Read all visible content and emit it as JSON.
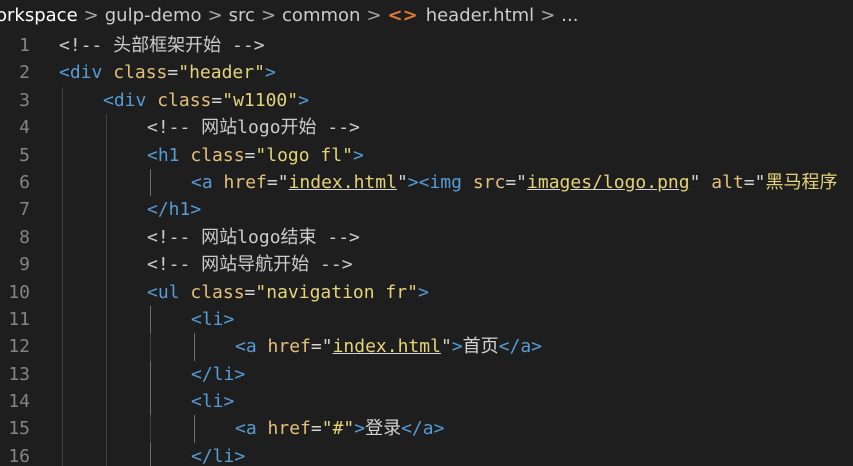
{
  "breadcrumb": [
    {
      "label": "orkspace",
      "icon": null
    },
    {
      "label": "gulp-demo",
      "icon": null
    },
    {
      "label": "src",
      "icon": null
    },
    {
      "label": "common",
      "icon": null
    },
    {
      "label": "header.html",
      "icon": "html-file-icon"
    },
    {
      "label": "...",
      "icon": null
    }
  ],
  "breadcrumb_separator": ">",
  "file_icon_glyph": "<>",
  "lines": [
    {
      "number": "1",
      "indent": 0,
      "tokens": [
        {
          "t": "comment",
          "v": "<!-- 头部框架开始 -->"
        }
      ]
    },
    {
      "number": "2",
      "indent": 0,
      "tokens": [
        {
          "t": "tag",
          "v": "<div"
        },
        {
          "t": "space",
          "v": " "
        },
        {
          "t": "attr",
          "v": "class"
        },
        {
          "t": "punc",
          "v": "="
        },
        {
          "t": "str",
          "v": "\"header\""
        },
        {
          "t": "tag",
          "v": ">"
        }
      ]
    },
    {
      "number": "3",
      "indent": 1,
      "tokens": [
        {
          "t": "tag",
          "v": "<div"
        },
        {
          "t": "space",
          "v": " "
        },
        {
          "t": "attr",
          "v": "class"
        },
        {
          "t": "punc",
          "v": "="
        },
        {
          "t": "str",
          "v": "\"w1100\""
        },
        {
          "t": "tag",
          "v": ">"
        }
      ]
    },
    {
      "number": "4",
      "indent": 2,
      "tokens": [
        {
          "t": "comment",
          "v": "<!-- 网站logo开始 -->"
        }
      ]
    },
    {
      "number": "5",
      "indent": 2,
      "tokens": [
        {
          "t": "tag",
          "v": "<h1"
        },
        {
          "t": "space",
          "v": " "
        },
        {
          "t": "attr",
          "v": "class"
        },
        {
          "t": "punc",
          "v": "="
        },
        {
          "t": "str",
          "v": "\"logo fl\""
        },
        {
          "t": "tag",
          "v": ">"
        }
      ]
    },
    {
      "number": "6",
      "indent": 3,
      "tokens": [
        {
          "t": "tag",
          "v": "<a"
        },
        {
          "t": "space",
          "v": " "
        },
        {
          "t": "attr",
          "v": "href"
        },
        {
          "t": "punc",
          "v": "=\""
        },
        {
          "t": "link",
          "v": "index.html"
        },
        {
          "t": "punc",
          "v": "\""
        },
        {
          "t": "tag",
          "v": "><img"
        },
        {
          "t": "space",
          "v": " "
        },
        {
          "t": "attr",
          "v": "src"
        },
        {
          "t": "punc",
          "v": "=\""
        },
        {
          "t": "link",
          "v": "images/logo.png"
        },
        {
          "t": "punc",
          "v": "\""
        },
        {
          "t": "space",
          "v": " "
        },
        {
          "t": "attr",
          "v": "alt"
        },
        {
          "t": "punc",
          "v": "=\""
        },
        {
          "t": "str",
          "v": "黑马程序"
        }
      ]
    },
    {
      "number": "7",
      "indent": 2,
      "tokens": [
        {
          "t": "tag",
          "v": "</h1>"
        }
      ]
    },
    {
      "number": "8",
      "indent": 2,
      "tokens": [
        {
          "t": "comment",
          "v": "<!-- 网站logo结束 -->"
        }
      ]
    },
    {
      "number": "9",
      "indent": 2,
      "tokens": [
        {
          "t": "comment",
          "v": "<!-- 网站导航开始 -->"
        }
      ]
    },
    {
      "number": "10",
      "indent": 2,
      "tokens": [
        {
          "t": "tag",
          "v": "<ul"
        },
        {
          "t": "space",
          "v": " "
        },
        {
          "t": "attr",
          "v": "class"
        },
        {
          "t": "punc",
          "v": "="
        },
        {
          "t": "str",
          "v": "\"navigation fr\""
        },
        {
          "t": "tag",
          "v": ">"
        }
      ]
    },
    {
      "number": "11",
      "indent": 3,
      "tokens": [
        {
          "t": "tag",
          "v": "<li>"
        }
      ]
    },
    {
      "number": "12",
      "indent": 4,
      "tokens": [
        {
          "t": "tag",
          "v": "<a"
        },
        {
          "t": "space",
          "v": " "
        },
        {
          "t": "attr",
          "v": "href"
        },
        {
          "t": "punc",
          "v": "=\""
        },
        {
          "t": "link",
          "v": "index.html"
        },
        {
          "t": "punc",
          "v": "\""
        },
        {
          "t": "tag",
          "v": ">"
        },
        {
          "t": "text",
          "v": "首页"
        },
        {
          "t": "tag",
          "v": "</a>"
        }
      ]
    },
    {
      "number": "13",
      "indent": 3,
      "tokens": [
        {
          "t": "tag",
          "v": "</li>"
        }
      ]
    },
    {
      "number": "14",
      "indent": 3,
      "tokens": [
        {
          "t": "tag",
          "v": "<li>"
        }
      ]
    },
    {
      "number": "15",
      "indent": 4,
      "tokens": [
        {
          "t": "tag",
          "v": "<a"
        },
        {
          "t": "space",
          "v": " "
        },
        {
          "t": "attr",
          "v": "href"
        },
        {
          "t": "punc",
          "v": "="
        },
        {
          "t": "str",
          "v": "\"#\""
        },
        {
          "t": "tag",
          "v": ">"
        },
        {
          "t": "text",
          "v": "登录"
        },
        {
          "t": "tag",
          "v": "</a>"
        }
      ]
    },
    {
      "number": "16",
      "indent": 3,
      "tokens": [
        {
          "t": "tag",
          "v": "</li>"
        }
      ]
    }
  ],
  "colors": {
    "background": "#1e1e1e",
    "line_number": "#858585",
    "comment": "#cccccc",
    "tag": "#569cd6",
    "attribute": "#e5c07b",
    "string": "#e5d37a",
    "text": "#d4d4d4",
    "indent_guide": "#404040"
  }
}
